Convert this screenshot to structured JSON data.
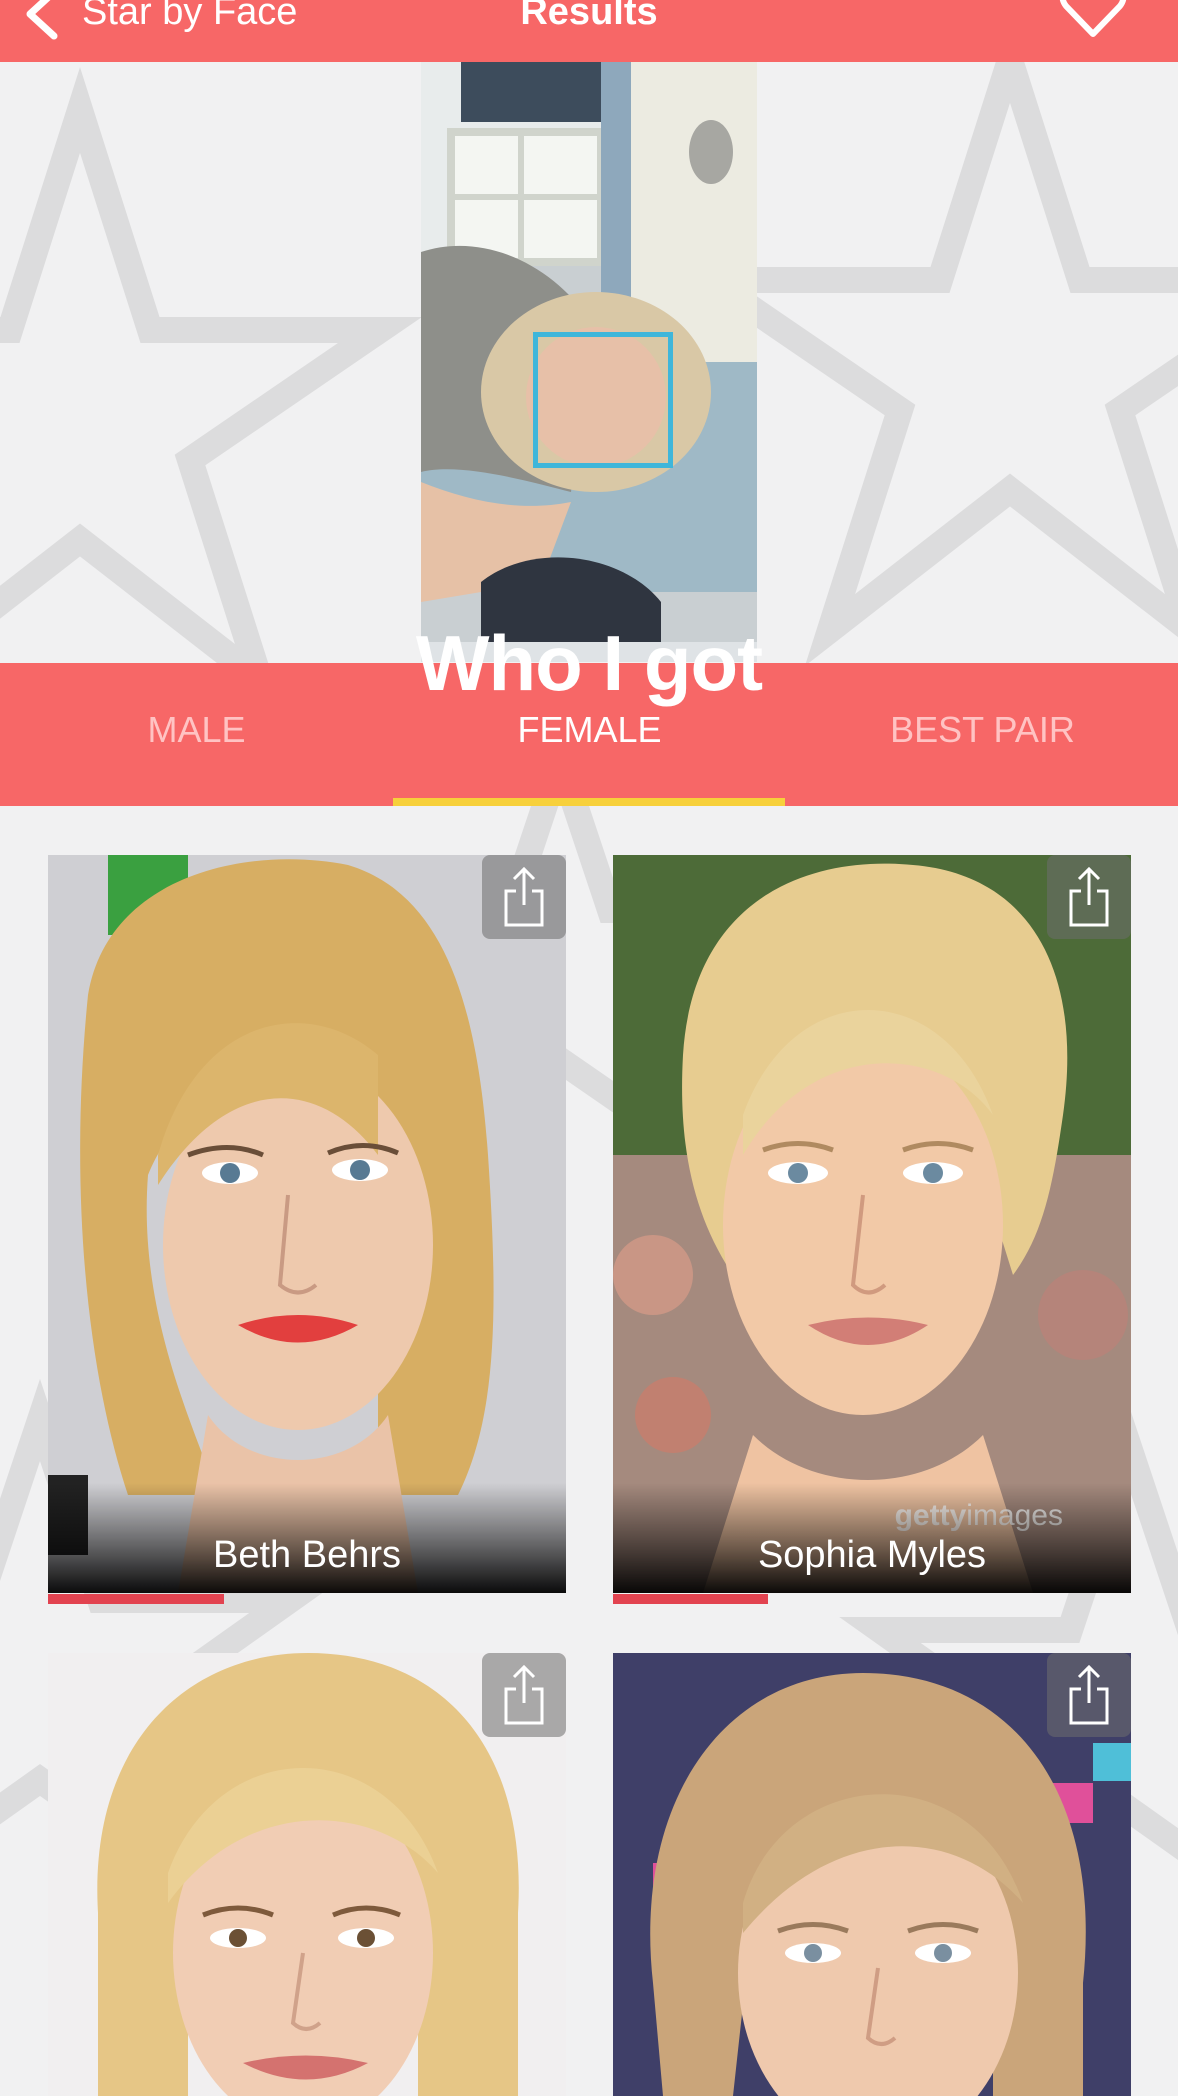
{
  "nav": {
    "back_label": "Star by Face",
    "title": "Results"
  },
  "header": {
    "title": "Who I got"
  },
  "tabs": [
    {
      "label": "MALE",
      "active": false
    },
    {
      "label": "FEMALE",
      "active": true
    },
    {
      "label": "BEST PAIR",
      "active": false
    }
  ],
  "results": [
    {
      "name": "Beth Behrs",
      "match": 0.34
    },
    {
      "name": "Sophia Myles",
      "match": 0.3,
      "watermark": "gettyimages"
    },
    {
      "name": "",
      "match": null
    },
    {
      "name": "",
      "match": null
    }
  ],
  "colors": {
    "accent": "#f76767",
    "tab_indicator": "#f7d03b",
    "match_bar": "#e24350",
    "face_box": "#3fb6da"
  }
}
